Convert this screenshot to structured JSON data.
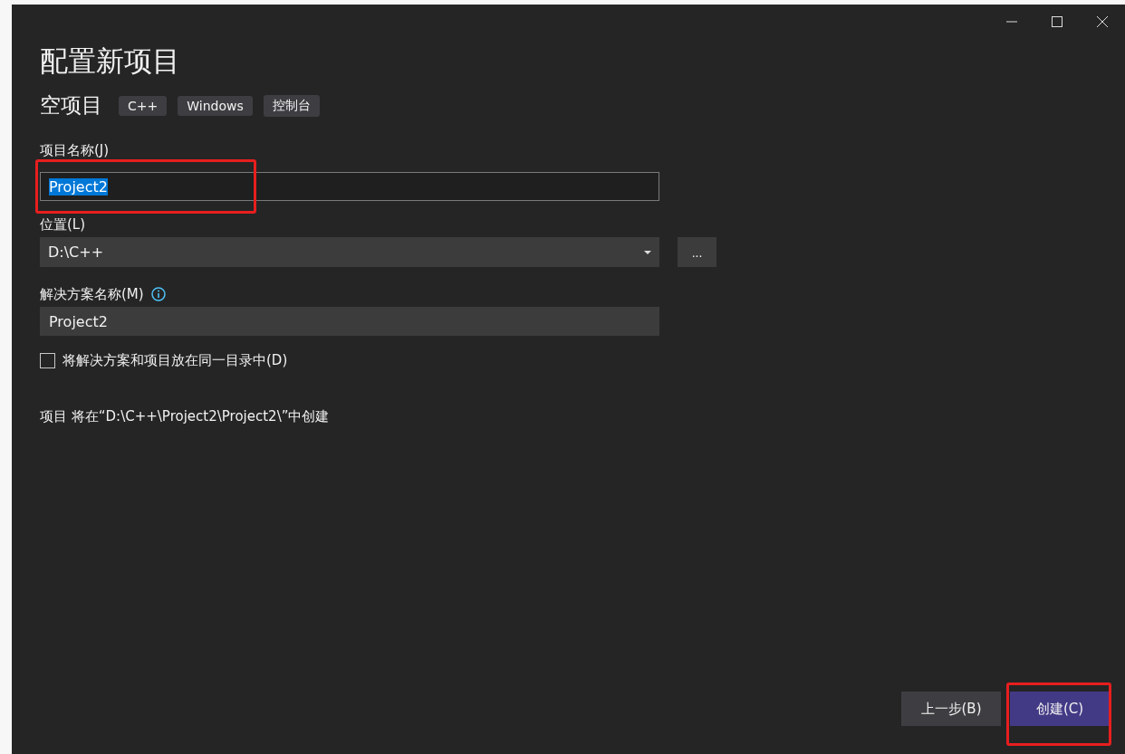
{
  "dialog": {
    "title": "配置新项目",
    "window_controls": [
      {
        "kind": "minimize"
      },
      {
        "kind": "maximize"
      },
      {
        "kind": "close"
      }
    ]
  },
  "template": {
    "name": "空项目",
    "tags": [
      "C++",
      "Windows",
      "控制台"
    ]
  },
  "project_name": {
    "label": "项目名称(J)",
    "value": "Project2",
    "text_selected": true,
    "highlighted": true
  },
  "location": {
    "label": "位置(L)",
    "value": "D:\\C++",
    "browse": "..."
  },
  "solution_name": {
    "label": "解决方案名称(M)",
    "value": "Project2"
  },
  "same_directory": {
    "label": "将解决方案和项目放在同一目录中(D)",
    "checked": false
  },
  "summary": "项目 将在“D:\\C++\\Project2\\Project2\\”中创建",
  "buttons": [
    {
      "label": "上一步(B)",
      "kind": "secondary",
      "highlighted": false
    },
    {
      "label": "创建(C)",
      "kind": "primary",
      "highlighted": true
    }
  ]
}
